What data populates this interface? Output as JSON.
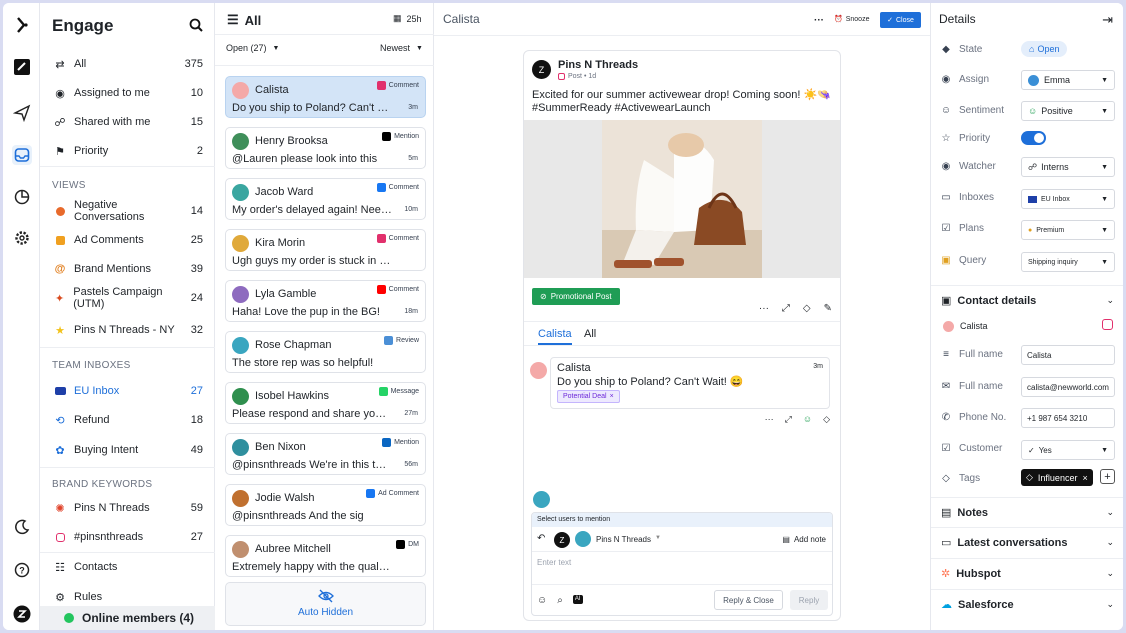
{
  "nav": {
    "title": "Engage",
    "main": [
      {
        "label": "All",
        "count": "375"
      },
      {
        "label": "Assigned to me",
        "count": "10"
      },
      {
        "label": "Shared with me",
        "count": "15"
      },
      {
        "label": "Priority",
        "count": "2"
      }
    ],
    "views_label": "VIEWS",
    "views": [
      {
        "label": "Negative Conversations",
        "count": "14"
      },
      {
        "label": "Ad Comments",
        "count": "25"
      },
      {
        "label": "Brand Mentions",
        "count": "39"
      },
      {
        "label": "Pastels Campaign (UTM)",
        "count": "24"
      },
      {
        "label": "Pins N Threads - NY",
        "count": "32"
      }
    ],
    "team_label": "TEAM INBOXES",
    "team": [
      {
        "label": "EU Inbox",
        "count": "27"
      },
      {
        "label": "Refund",
        "count": "18"
      },
      {
        "label": "Buying Intent",
        "count": "49"
      }
    ],
    "brand_label": "BRAND KEYWORDS",
    "brand": [
      {
        "label": "Pins N Threads",
        "count": "59"
      },
      {
        "label": "#pinsnthreads",
        "count": "27"
      }
    ],
    "contacts": "Contacts",
    "rules": "Rules",
    "online": "Online members (4)"
  },
  "list": {
    "title": "All",
    "time": "25h",
    "filter": "Open (27)",
    "sort": "Newest",
    "cards": [
      {
        "name": "Calista",
        "channel": "Comment",
        "msg": "Do you ship to Poland? Can't Wait!",
        "time": "3m",
        "color": "#e1306c",
        "av": "#f4a9a8"
      },
      {
        "name": "Henry Brooksa",
        "channel": "Mention",
        "msg": "@Lauren please look into this",
        "time": "5m",
        "color": "#000000",
        "av": "#3f8f5a"
      },
      {
        "name": "Jacob Ward",
        "channel": "Comment",
        "msg": "My order's delayed again! Need h...",
        "time": "10m",
        "color": "#1877f2",
        "av": "#3aa6a0"
      },
      {
        "name": "Kira Morin",
        "channel": "Comment",
        "msg": "Ugh guys my order is stuck in cu...",
        "time": "",
        "color": "#e1306c",
        "av": "#e0a93a"
      },
      {
        "name": "Lyla Gamble",
        "channel": "Comment",
        "msg": "Haha! Love the pup in the BG!",
        "time": "18m",
        "color": "#ff0000",
        "av": "#8e6bbf"
      },
      {
        "name": "Rose Chapman",
        "channel": "Review",
        "msg": "The store rep was so helpful!",
        "time": "",
        "color": "#4b8fd6",
        "av": "#3aa6c0"
      },
      {
        "name": "Isobel Hawkins",
        "channel": "Message",
        "msg": "Please respond and share your in...",
        "time": "27m",
        "color": "#25d366",
        "av": "#2f8f4e"
      },
      {
        "name": "Ben Nixon",
        "channel": "Mention",
        "msg": "@pinsnthreads We're in this toge...",
        "time": "56m",
        "color": "#0a66c2",
        "av": "#2f8f9e"
      },
      {
        "name": "Jodie Walsh",
        "channel": "Ad Comment",
        "msg": "@pinsnthreads And the sig",
        "time": "",
        "color": "#1877f2",
        "av": "#c0702f"
      },
      {
        "name": "Aubree Mitchell",
        "channel": "DM",
        "msg": "Extremely happy with the quality...",
        "time": "",
        "color": "#000000",
        "av": "#c08f6f"
      }
    ],
    "hidden": "Auto Hidden"
  },
  "center": {
    "contact": "Calista",
    "snooze": "Snooze",
    "close": "Close",
    "post": {
      "brand": "Pins N Threads",
      "meta": "Post • 1d",
      "text": "Excited for our summer activewear drop! Coming soon! ☀️👒 #SummerReady #ActivewearLaunch",
      "tag": "Promotional Post"
    },
    "tabs": [
      "Calista",
      "All"
    ],
    "comment": {
      "name": "Calista",
      "time": "3m",
      "text": "Do you ship to Poland? Can't Wait! 😄",
      "tag": "Potential Deal"
    },
    "reply": {
      "mention": "Select users to mention",
      "account": "Pins N Threads",
      "add_note": "Add note",
      "placeholder": "Enter text",
      "reply_close": "Reply & Close",
      "reply": "Reply"
    }
  },
  "details": {
    "title": "Details",
    "rows": [
      {
        "label": "State",
        "value": "Open"
      },
      {
        "label": "Assign",
        "value": "Emma"
      },
      {
        "label": "Sentiment",
        "value": "Positive"
      },
      {
        "label": "Priority",
        "value": ""
      },
      {
        "label": "Watcher",
        "value": "Interns"
      },
      {
        "label": "Inboxes",
        "value": "EU Inbox"
      },
      {
        "label": "Plans",
        "value": "Premium"
      },
      {
        "label": "Query",
        "value": "Shipping inquiry"
      }
    ],
    "contact_title": "Contact details",
    "contact_name": "Calista",
    "contact": [
      {
        "label": "Full name",
        "value": "Calista"
      },
      {
        "label": "Full name",
        "value": "calista@newworld.com"
      },
      {
        "label": "Phone No.",
        "value": "+1 987 654 3210"
      },
      {
        "label": "Customer",
        "value": "Yes"
      },
      {
        "label": "Tags",
        "value": "Influencer"
      }
    ],
    "sections": [
      "Notes",
      "Latest conversations",
      "Hubspot",
      "Salesforce"
    ]
  }
}
